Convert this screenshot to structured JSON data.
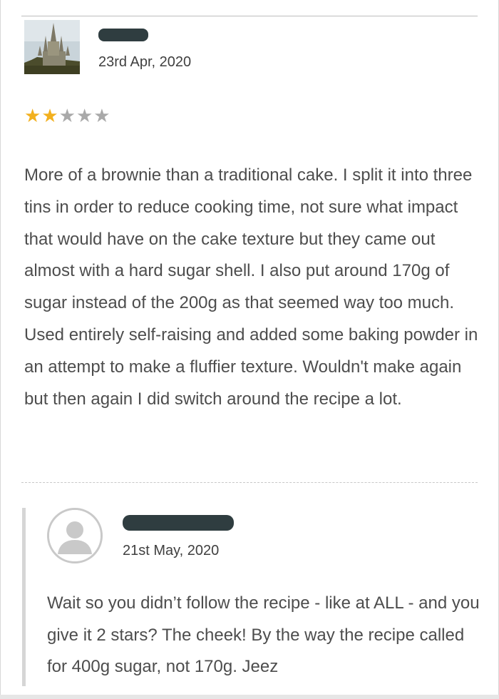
{
  "review": {
    "author_avatar_icon": "castle-photo-avatar",
    "date": "23rd Apr, 2020",
    "rating": 2,
    "rating_max": 5,
    "star_colors": {
      "filled": "#f2b01e",
      "empty": "#a9a9a9"
    },
    "text": "More of a brownie than a traditional cake. I split it into three tins in order to reduce cooking time, not sure what impact that would have on the cake texture but they came out almost with a hard sugar shell. I also put around 170g of sugar instead of the 200g as that seemed way too much. Used entirely self-raising and added some baking powder in an attempt to make a fluffier texture. Wouldn't make again but then again I did switch around the recipe a lot."
  },
  "reply": {
    "author_avatar_icon": "default-user-avatar-icon",
    "date": "21st May, 2020",
    "text": "Wait so you didn’t follow the recipe - like at ALL - and you give it 2 stars? The cheek! By the way the recipe called for 400g sugar, not 170g. Jeez"
  }
}
